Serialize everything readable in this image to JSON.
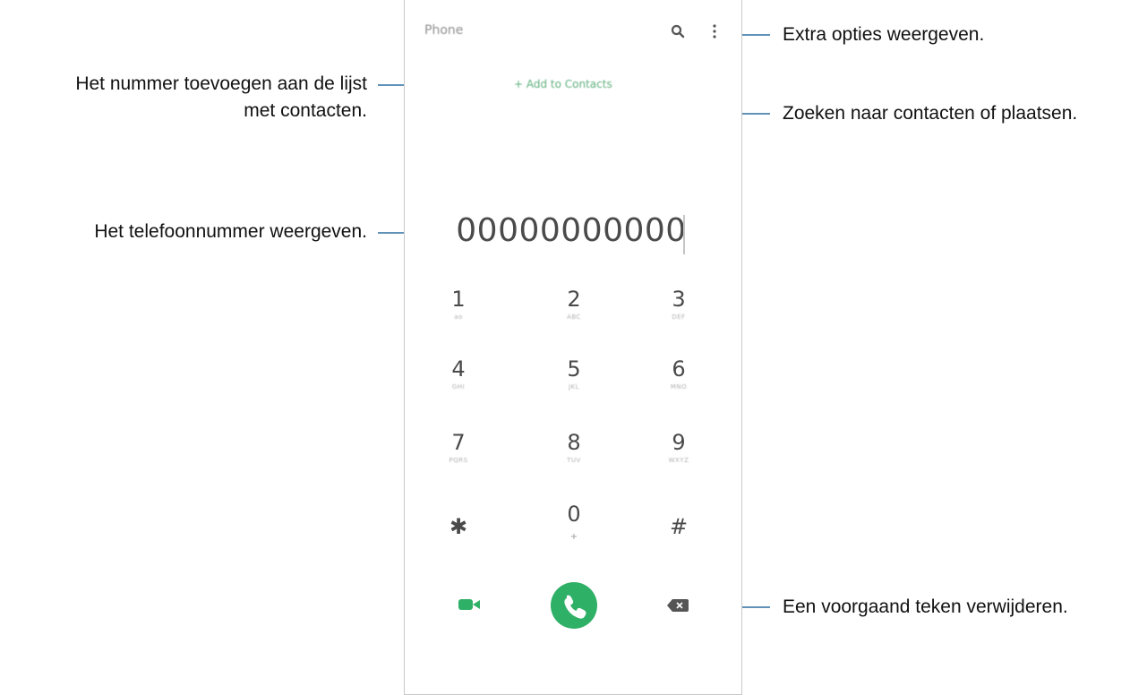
{
  "phone": {
    "title": "Phone",
    "add_to_contacts": "+ Add to Contacts",
    "number": "00000000000",
    "keypad": [
      {
        "digit": "1",
        "letters": "ao"
      },
      {
        "digit": "2",
        "letters": "ABC"
      },
      {
        "digit": "3",
        "letters": "DEF"
      },
      {
        "digit": "4",
        "letters": "GHI"
      },
      {
        "digit": "5",
        "letters": "JKL"
      },
      {
        "digit": "6",
        "letters": "MNO"
      },
      {
        "digit": "7",
        "letters": "PQRS"
      },
      {
        "digit": "8",
        "letters": "TUV"
      },
      {
        "digit": "9",
        "letters": "WXYZ"
      },
      {
        "digit": "✱",
        "letters": ""
      },
      {
        "digit": "0",
        "letters": "+"
      },
      {
        "digit": "#",
        "letters": ""
      }
    ],
    "icons": {
      "search": "search-icon",
      "more": "more-options-icon",
      "video": "video-call-icon",
      "call": "phone-call-icon",
      "delete": "backspace-icon"
    },
    "colors": {
      "accent_green": "#2fb067",
      "text_gray": "#4a4a4a",
      "callout_line": "#2b6f9f"
    }
  },
  "callouts": {
    "extra_options": "Extra opties weergeven.",
    "add_number_line1": "Het nummer toevoegen aan de lijst",
    "add_number_line2": "met contacten.",
    "search": "Zoeken naar contacten of plaatsen.",
    "show_number": "Het telefoonnummer weergeven.",
    "delete_char": "Een voorgaand teken verwijderen."
  }
}
